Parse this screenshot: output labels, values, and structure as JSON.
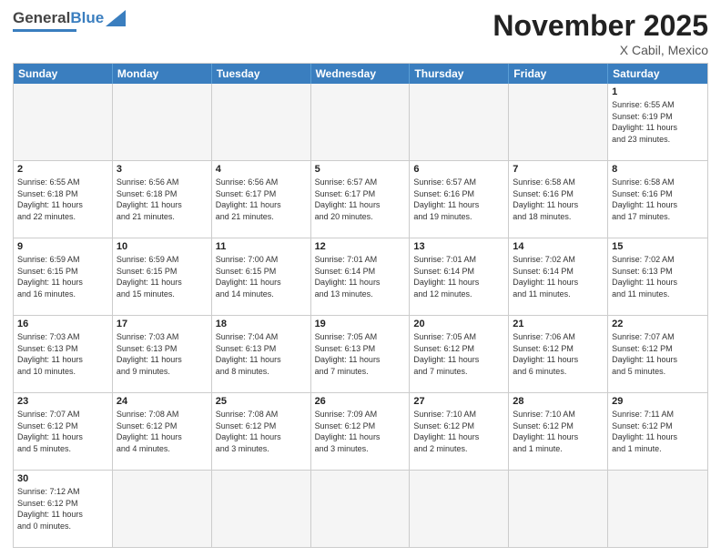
{
  "header": {
    "month_title": "November 2025",
    "location": "X Cabil, Mexico",
    "logo_general": "General",
    "logo_blue": "Blue"
  },
  "days_of_week": [
    "Sunday",
    "Monday",
    "Tuesday",
    "Wednesday",
    "Thursday",
    "Friday",
    "Saturday"
  ],
  "weeks": [
    [
      {
        "day": "",
        "info": ""
      },
      {
        "day": "",
        "info": ""
      },
      {
        "day": "",
        "info": ""
      },
      {
        "day": "",
        "info": ""
      },
      {
        "day": "",
        "info": ""
      },
      {
        "day": "",
        "info": ""
      },
      {
        "day": "1",
        "info": "Sunrise: 6:55 AM\nSunset: 6:19 PM\nDaylight: 11 hours\nand 23 minutes."
      }
    ],
    [
      {
        "day": "2",
        "info": "Sunrise: 6:55 AM\nSunset: 6:18 PM\nDaylight: 11 hours\nand 22 minutes."
      },
      {
        "day": "3",
        "info": "Sunrise: 6:56 AM\nSunset: 6:18 PM\nDaylight: 11 hours\nand 21 minutes."
      },
      {
        "day": "4",
        "info": "Sunrise: 6:56 AM\nSunset: 6:17 PM\nDaylight: 11 hours\nand 21 minutes."
      },
      {
        "day": "5",
        "info": "Sunrise: 6:57 AM\nSunset: 6:17 PM\nDaylight: 11 hours\nand 20 minutes."
      },
      {
        "day": "6",
        "info": "Sunrise: 6:57 AM\nSunset: 6:16 PM\nDaylight: 11 hours\nand 19 minutes."
      },
      {
        "day": "7",
        "info": "Sunrise: 6:58 AM\nSunset: 6:16 PM\nDaylight: 11 hours\nand 18 minutes."
      },
      {
        "day": "8",
        "info": "Sunrise: 6:58 AM\nSunset: 6:16 PM\nDaylight: 11 hours\nand 17 minutes."
      }
    ],
    [
      {
        "day": "9",
        "info": "Sunrise: 6:59 AM\nSunset: 6:15 PM\nDaylight: 11 hours\nand 16 minutes."
      },
      {
        "day": "10",
        "info": "Sunrise: 6:59 AM\nSunset: 6:15 PM\nDaylight: 11 hours\nand 15 minutes."
      },
      {
        "day": "11",
        "info": "Sunrise: 7:00 AM\nSunset: 6:15 PM\nDaylight: 11 hours\nand 14 minutes."
      },
      {
        "day": "12",
        "info": "Sunrise: 7:01 AM\nSunset: 6:14 PM\nDaylight: 11 hours\nand 13 minutes."
      },
      {
        "day": "13",
        "info": "Sunrise: 7:01 AM\nSunset: 6:14 PM\nDaylight: 11 hours\nand 12 minutes."
      },
      {
        "day": "14",
        "info": "Sunrise: 7:02 AM\nSunset: 6:14 PM\nDaylight: 11 hours\nand 11 minutes."
      },
      {
        "day": "15",
        "info": "Sunrise: 7:02 AM\nSunset: 6:13 PM\nDaylight: 11 hours\nand 11 minutes."
      }
    ],
    [
      {
        "day": "16",
        "info": "Sunrise: 7:03 AM\nSunset: 6:13 PM\nDaylight: 11 hours\nand 10 minutes."
      },
      {
        "day": "17",
        "info": "Sunrise: 7:03 AM\nSunset: 6:13 PM\nDaylight: 11 hours\nand 9 minutes."
      },
      {
        "day": "18",
        "info": "Sunrise: 7:04 AM\nSunset: 6:13 PM\nDaylight: 11 hours\nand 8 minutes."
      },
      {
        "day": "19",
        "info": "Sunrise: 7:05 AM\nSunset: 6:13 PM\nDaylight: 11 hours\nand 7 minutes."
      },
      {
        "day": "20",
        "info": "Sunrise: 7:05 AM\nSunset: 6:12 PM\nDaylight: 11 hours\nand 7 minutes."
      },
      {
        "day": "21",
        "info": "Sunrise: 7:06 AM\nSunset: 6:12 PM\nDaylight: 11 hours\nand 6 minutes."
      },
      {
        "day": "22",
        "info": "Sunrise: 7:07 AM\nSunset: 6:12 PM\nDaylight: 11 hours\nand 5 minutes."
      }
    ],
    [
      {
        "day": "23",
        "info": "Sunrise: 7:07 AM\nSunset: 6:12 PM\nDaylight: 11 hours\nand 5 minutes."
      },
      {
        "day": "24",
        "info": "Sunrise: 7:08 AM\nSunset: 6:12 PM\nDaylight: 11 hours\nand 4 minutes."
      },
      {
        "day": "25",
        "info": "Sunrise: 7:08 AM\nSunset: 6:12 PM\nDaylight: 11 hours\nand 3 minutes."
      },
      {
        "day": "26",
        "info": "Sunrise: 7:09 AM\nSunset: 6:12 PM\nDaylight: 11 hours\nand 3 minutes."
      },
      {
        "day": "27",
        "info": "Sunrise: 7:10 AM\nSunset: 6:12 PM\nDaylight: 11 hours\nand 2 minutes."
      },
      {
        "day": "28",
        "info": "Sunrise: 7:10 AM\nSunset: 6:12 PM\nDaylight: 11 hours\nand 1 minute."
      },
      {
        "day": "29",
        "info": "Sunrise: 7:11 AM\nSunset: 6:12 PM\nDaylight: 11 hours\nand 1 minute."
      }
    ],
    [
      {
        "day": "30",
        "info": "Sunrise: 7:12 AM\nSunset: 6:12 PM\nDaylight: 11 hours\nand 0 minutes."
      },
      {
        "day": "",
        "info": ""
      },
      {
        "day": "",
        "info": ""
      },
      {
        "day": "",
        "info": ""
      },
      {
        "day": "",
        "info": ""
      },
      {
        "day": "",
        "info": ""
      },
      {
        "day": "",
        "info": ""
      }
    ]
  ]
}
